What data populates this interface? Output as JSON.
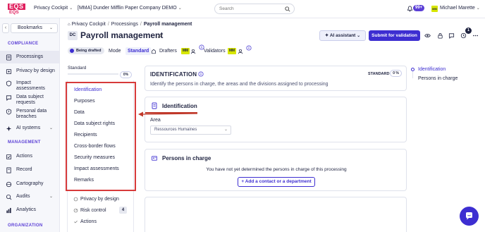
{
  "topbar": {
    "logo_top": "EQS",
    "logo_bottom": "EQS",
    "app_name": "Privacy Cockpit",
    "company": "[MMA] Dunder Mifflin Paper Company DEMO",
    "search_placeholder": "Search",
    "notif_count": "99+",
    "user_initials": "MM",
    "user_name": "Michael Marette"
  },
  "sidebar": {
    "bookmarks_label": "Bookmarks",
    "sections": [
      {
        "label": "COMPLIANCE"
      },
      {
        "label": "MANAGEMENT"
      },
      {
        "label": "ORGANIZATION"
      }
    ],
    "compliance_items": [
      {
        "label": "Processings",
        "icon": "processings-icon"
      },
      {
        "label": "Privacy by design",
        "icon": "privacy-design-icon"
      },
      {
        "label": "Impact assessments",
        "icon": "impact-icon"
      },
      {
        "label": "Data subject requests",
        "icon": "requests-icon"
      },
      {
        "label": "Personal data breaches",
        "icon": "breach-icon"
      },
      {
        "label": "AI systems",
        "icon": "ai-icon"
      }
    ],
    "management_items": [
      {
        "label": "Actions",
        "icon": "actions-icon"
      },
      {
        "label": "Record",
        "icon": "record-icon"
      },
      {
        "label": "Cartography",
        "icon": "cartography-icon"
      },
      {
        "label": "Audits",
        "icon": "audits-icon"
      },
      {
        "label": "Analytics",
        "icon": "analytics-icon"
      }
    ]
  },
  "breadcrumb": {
    "items": [
      "Privacy Cockpit",
      "Processings",
      "Payroll management"
    ]
  },
  "header": {
    "tag": "DC",
    "title": "Payroll management",
    "ai_button": "AI assistant",
    "submit_button": "Submit for validation",
    "notif_count": "1",
    "status": "Being drafted",
    "mode_label": "Mode",
    "mode_value": "Standard",
    "drafters_label": "Drafters",
    "drafter_initials": "MM",
    "validators_label": "Validators",
    "validator_initials": "MM"
  },
  "form_nav": {
    "standard_label": "Standard",
    "standard_pct": "0%",
    "items": [
      "Identification",
      "Purposes",
      "Data",
      "Data subject rights",
      "Recipients",
      "Cross-border flows",
      "Security measures",
      "Impact assessments",
      "Remarks"
    ],
    "sub_items": [
      {
        "label": "Privacy by design"
      },
      {
        "label": "Risk control",
        "count": "4"
      },
      {
        "label": "Actions"
      }
    ]
  },
  "identification": {
    "title": "IDENTIFICATION",
    "standard_label": "STANDARD",
    "pct": "0 %",
    "description": "Identify the persons in charge, the areas and the divisions assigned to processing"
  },
  "area_card": {
    "title": "Identification",
    "field_label": "Area",
    "field_value": "Ressources Humaines"
  },
  "persons_card": {
    "title": "Persons in charge",
    "message": "You have not yet determined the persons in charge of this processing",
    "add_button": "+ Add a contact or a department"
  },
  "toc": {
    "items": [
      "Identification",
      "Persons in charge"
    ]
  },
  "colors": {
    "accent": "#3d2ed1",
    "brand": "#e0205e",
    "highlight": "#d73a3a",
    "initials_bg": "#d7e600"
  }
}
